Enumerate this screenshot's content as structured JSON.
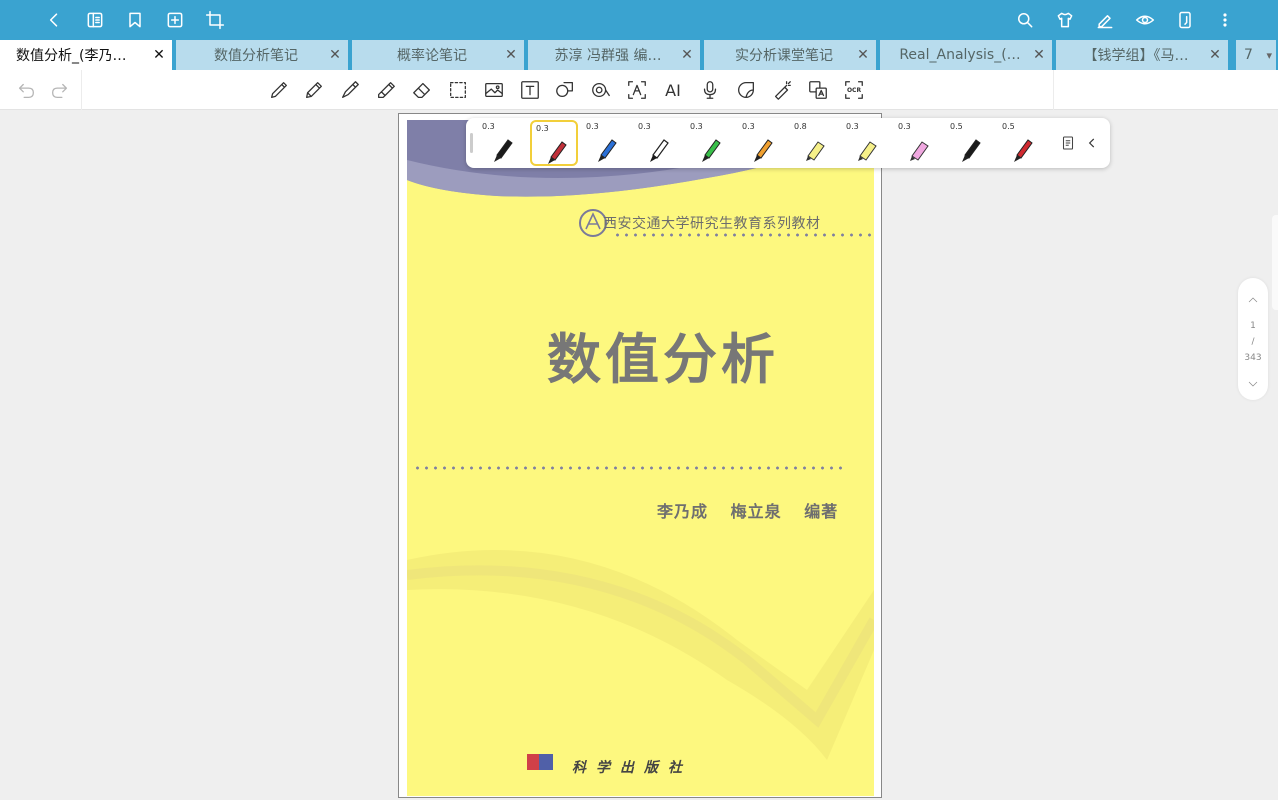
{
  "topbar": {
    "left_icons": [
      "back-icon",
      "outline-icon",
      "bookmark-icon",
      "add-page-icon",
      "crop-icon"
    ],
    "right_icons": [
      "search-icon",
      "theme-icon",
      "pen-edit-icon",
      "eye-icon",
      "device-icon",
      "more-icon"
    ]
  },
  "tabs": [
    {
      "label": "数值分析_(李乃…",
      "active": true
    },
    {
      "label": "数值分析笔记",
      "active": false
    },
    {
      "label": "概率论笔记",
      "active": false
    },
    {
      "label": "苏淳 冯群强 编…",
      "active": false
    },
    {
      "label": "实分析课堂笔记",
      "active": false
    },
    {
      "label": "Real_Analysis_(…",
      "active": false
    },
    {
      "label": "【钱学组】《马…",
      "active": false
    },
    {
      "label": "7",
      "active": false
    }
  ],
  "tab_close": "✕",
  "tab_overflow": "▾",
  "toolbar": {
    "tools": [
      "pen-icon",
      "pencil-icon",
      "fountain-pen-icon",
      "highlighter-icon",
      "eraser-icon",
      "lasso-select-icon",
      "image-icon",
      "text-box-icon",
      "shape-icon",
      "tape-icon",
      "text-recognize-icon",
      "ai-icon",
      "microphone-icon",
      "sticker-icon",
      "laser-pointer-icon",
      "translate-icon",
      "ocr-icon"
    ],
    "ai_label": "AI",
    "ocr_label": "OCR"
  },
  "pen_palette": {
    "pens": [
      {
        "size": "0.3",
        "color": "#1a1a1a",
        "type": "marker"
      },
      {
        "size": "0.3",
        "color": "#c0303a",
        "type": "marker",
        "selected": true
      },
      {
        "size": "0.3",
        "color": "#2a6fd6",
        "type": "marker"
      },
      {
        "size": "0.3",
        "color": "#1a1a1a",
        "type": "fineliner"
      },
      {
        "size": "0.3",
        "color": "#39c04a",
        "type": "marker"
      },
      {
        "size": "0.3",
        "color": "#f0a030",
        "type": "marker"
      },
      {
        "size": "0.8",
        "color": "#f6f089",
        "type": "highlighter"
      },
      {
        "size": "0.3",
        "color": "#f6f089",
        "type": "highlighter"
      },
      {
        "size": "0.3",
        "color": "#f0a8e0",
        "type": "highlighter"
      },
      {
        "size": "0.5",
        "color": "#1a1a1a",
        "type": "marker"
      },
      {
        "size": "0.5",
        "color": "#d02a30",
        "type": "marker"
      }
    ],
    "extra_icons": [
      "palette-settings-icon",
      "collapse-chevron-icon"
    ]
  },
  "cover": {
    "series": "西安交通大学研究生教育系列教材",
    "title": "数值分析",
    "authors": [
      "李乃成",
      "梅立泉",
      "编著"
    ],
    "publisher": "科学出版社",
    "background": "#fdf87f"
  },
  "page_nav": {
    "current": "1",
    "separator": "/",
    "total": "343"
  }
}
